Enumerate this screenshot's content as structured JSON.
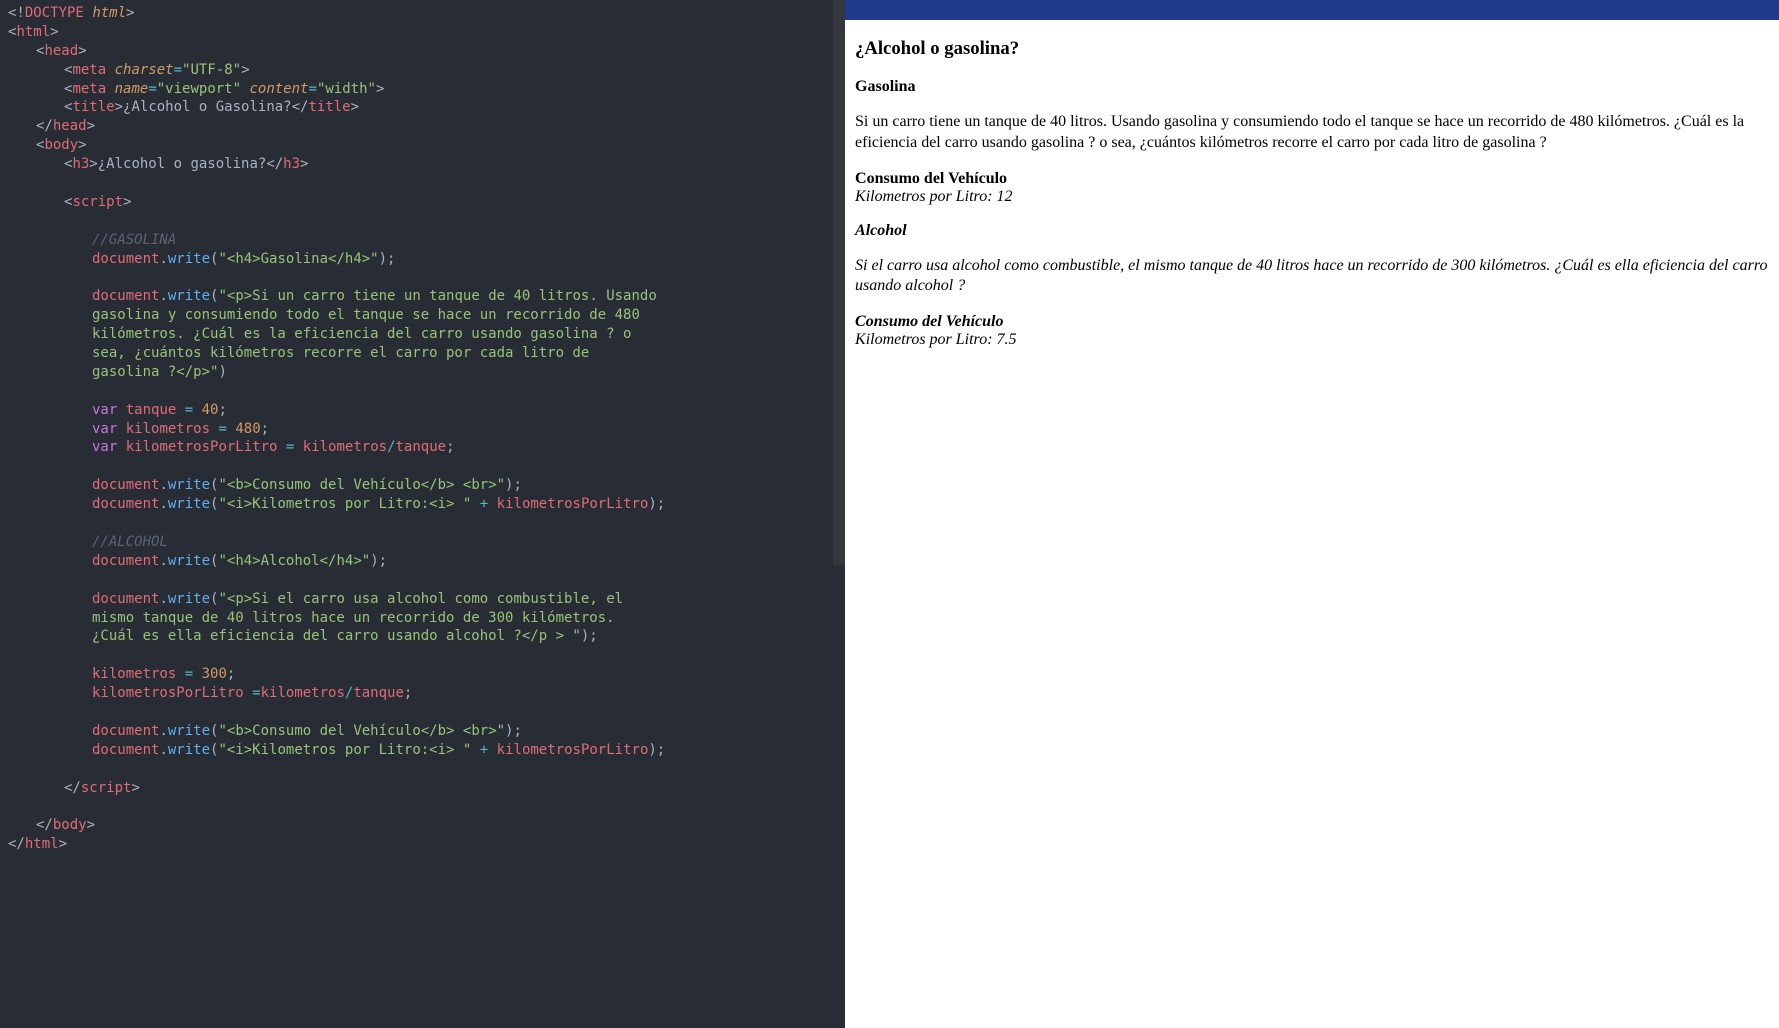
{
  "code": {
    "line1_doctype": "DOCTYPE",
    "line1_html": "html",
    "tag_html": "html",
    "tag_head": "head",
    "tag_meta": "meta",
    "attr_charset": "charset",
    "val_utf8": "\"UTF-8\"",
    "attr_name": "name",
    "val_viewport": "\"viewport\"",
    "attr_content": "content",
    "val_width": "\"width\"",
    "tag_title": "title",
    "title_text": "¿Alcohol o Gasolina?",
    "tag_body": "body",
    "tag_h3": "h3",
    "h3_text": "¿Alcohol o gasolina?",
    "tag_script": "script",
    "comment_gas": "//GASOLINA",
    "obj_document": "document",
    "func_write": "write",
    "str_gas_h4": "\"<h4>Gasolina</h4>\"",
    "str_gas_p1": "\"<p>Si un carro tiene un tanque de 40 litros. Usando ",
    "str_gas_p2": "gasolina y consumiendo todo el tanque se hace un recorrido de 480 ",
    "str_gas_p3": "kilómetros. ¿Cuál es la eficiencia del carro usando gasolina ? o ",
    "str_gas_p4": "sea, ¿cuántos kilómetros recorre el carro por cada litro de ",
    "str_gas_p5": "gasolina ?</p>\"",
    "kw_var": "var",
    "var_tanque": "tanque",
    "num_40": "40",
    "var_km": "kilometros",
    "num_480": "480",
    "var_kpl": "kilometrosPorLitro",
    "str_consumo": "\"<b>Consumo del Vehículo</b> <br>\"",
    "str_kpl": "\"<i>Kilometros por Litro:<i> \"",
    "comment_alc": "//ALCOHOL",
    "str_alc_h4": "\"<h4>Alcohol</h4>\"",
    "str_alc_p1": "\"<p>Si el carro usa alcohol como combustible, el ",
    "str_alc_p2": "mismo tanque de 40 litros hace un recorrido de 300 kilómetros. ",
    "str_alc_p3": "¿Cuál es ella eficiencia del carro usando alcohol ?</p > \"",
    "num_300": "300"
  },
  "preview": {
    "title": "¿Alcohol o gasolina?",
    "gas_heading": "Gasolina",
    "gas_text": "Si un carro tiene un tanque de 40 litros. Usando gasolina y consumiendo todo el tanque se hace un recorrido de 480 kilómetros. ¿Cuál es la eficiencia del carro usando gasolina ? o sea, ¿cuántos kilómetros recorre el carro por cada litro de gasolina ?",
    "consumo_label": "Consumo del Vehículo",
    "kpl_label_gas": "Kilometros por Litro: 12",
    "alc_heading": "Alcohol",
    "alc_text": "Si el carro usa alcohol como combustible, el mismo tanque de 40 litros hace un recorrido de 300 kilómetros. ¿Cuál es ella eficiencia del carro usando alcohol ?",
    "kpl_label_alc": "Kilometros por Litro: 7.5"
  }
}
